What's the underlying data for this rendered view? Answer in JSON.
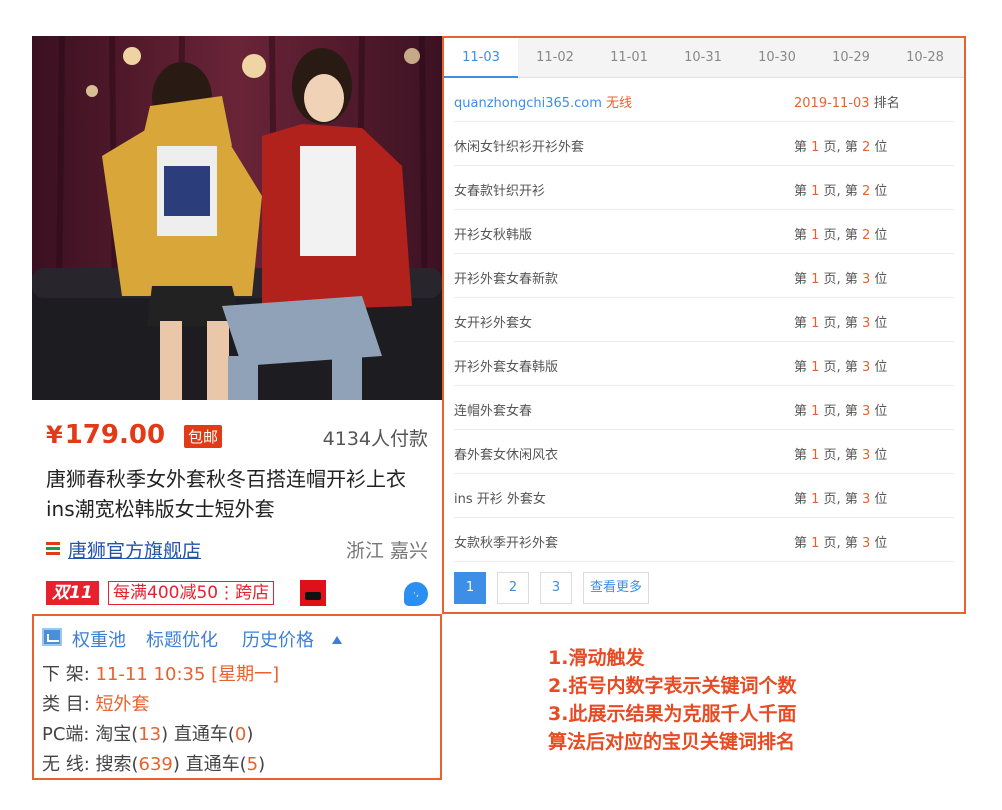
{
  "product": {
    "currency": "¥",
    "price": "179.00",
    "free_shipping": "包邮",
    "sales": "4134人付款",
    "title": "唐狮春秋季女外套秋冬百搭连帽开衫上衣ins潮宽松韩版女士短外套",
    "shop": "唐狮官方旗舰店",
    "location": "浙江 嘉兴",
    "promo_tag": "双11",
    "coupon": "每满400减50",
    "coupon_sep": "⋮",
    "coupon_suffix": "跨店",
    "icons": [
      "shop-stripe-icon",
      "tmall-icon",
      "chat-bubble-icon"
    ],
    "photo_colors": {
      "curtain": "#5c1f33",
      "sofa": "#1d1c20",
      "yellow_hoodie": "#d9a63a",
      "red_hoodie": "#b2221c"
    }
  },
  "plugin": {
    "tools": [
      "权重池",
      "标题优化",
      "历史价格"
    ],
    "offline_label": "下 架: ",
    "offline_value": "11-11 10:35 [星期一]",
    "category_label": "类 目: ",
    "category_value": "短外套",
    "pc_label": "PC端: 淘宝(",
    "pc_taobao": "13",
    "pc_mid": ") 直通车(",
    "pc_ztc": "0",
    "pc_end": ")",
    "wx_label": "无 线: 搜索(",
    "wx_search": "639",
    "wx_mid": ") 直通车(",
    "wx_ztc": "5",
    "wx_end": ")"
  },
  "ranking": {
    "tabs": [
      "11-03",
      "11-02",
      "11-01",
      "10-31",
      "10-30",
      "10-29",
      "10-28"
    ],
    "active_tab": 0,
    "header": {
      "site": "quanzhongchi365.com",
      "wireless": " 无线",
      "date": "2019-11-03",
      "rank_label": " 排名"
    },
    "pos_prefix": "第 ",
    "pos_mid": " 页, 第 ",
    "pos_suffix": " 位",
    "rows": [
      {
        "keyword": "休闲女针织衫开衫外套",
        "page": "1",
        "position": "2"
      },
      {
        "keyword": "女春款针织开衫",
        "page": "1",
        "position": "2"
      },
      {
        "keyword": "开衫女秋韩版",
        "page": "1",
        "position": "2"
      },
      {
        "keyword": "开衫外套女春新款",
        "page": "1",
        "position": "3"
      },
      {
        "keyword": "女开衫外套女",
        "page": "1",
        "position": "3"
      },
      {
        "keyword": "开衫外套女春韩版",
        "page": "1",
        "position": "3"
      },
      {
        "keyword": "连帽外套女春",
        "page": "1",
        "position": "3"
      },
      {
        "keyword": "春外套女休闲风衣",
        "page": "1",
        "position": "3"
      },
      {
        "keyword": "ins 开衫 外套女",
        "page": "1",
        "position": "3"
      },
      {
        "keyword": "女款秋季开衫外套",
        "page": "1",
        "position": "3"
      }
    ],
    "pages": [
      "1",
      "2",
      "3"
    ],
    "more": "查看更多",
    "accent": "#3d8ee6",
    "highlight": "#e8622e"
  },
  "notes": [
    "1.滑动触发",
    "2.括号内数字表示关键词个数",
    "3.此展示结果为克服千人千面",
    "算法后对应的宝贝关键词排名"
  ]
}
